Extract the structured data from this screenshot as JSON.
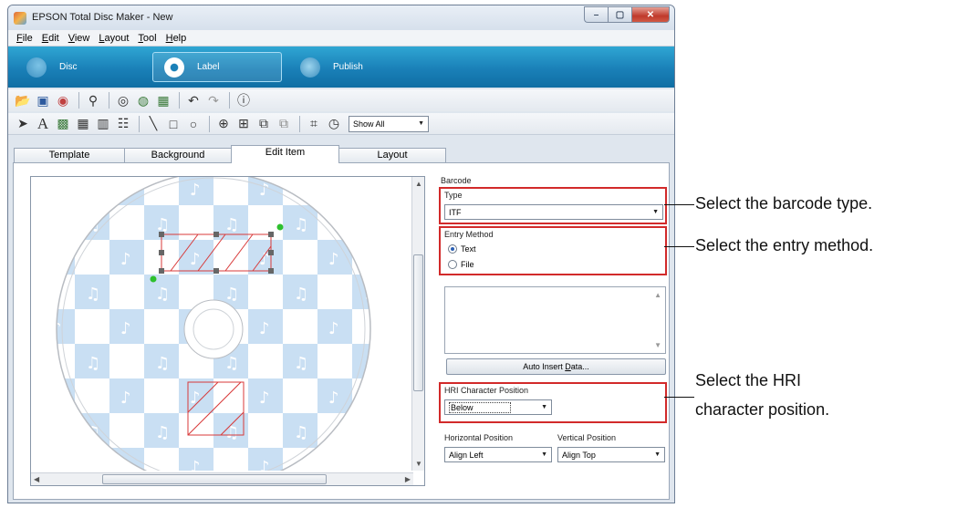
{
  "window": {
    "title": "EPSON Total Disc Maker - New"
  },
  "menu": [
    {
      "u": "F",
      "rest": "ile"
    },
    {
      "u": "E",
      "rest": "dit"
    },
    {
      "u": "V",
      "rest": "iew"
    },
    {
      "u": "L",
      "rest": "ayout"
    },
    {
      "u": "T",
      "rest": "ool"
    },
    {
      "u": "H",
      "rest": "elp"
    }
  ],
  "modes": {
    "disc": "Disc",
    "label": "Label",
    "publish": "Publish"
  },
  "toolbar": {
    "show_all": "Show All"
  },
  "tabs": [
    "Template",
    "Background",
    "Edit Item",
    "Layout"
  ],
  "panel": {
    "barcode_label": "Barcode",
    "type_label": "Type",
    "type_value": "ITF",
    "entry_label": "Entry Method",
    "entry_text": "Text",
    "entry_file": "File",
    "auto_insert_pre": "Auto Insert ",
    "auto_insert_ul": "D",
    "auto_insert_post": "ata...",
    "hri_label": "HRI Character Position",
    "hri_value": "Below",
    "hpos_label": "Horizontal Position",
    "hpos_value": "Align Left",
    "vpos_label": "Vertical Position",
    "vpos_value": "Align Top"
  },
  "callouts": {
    "type": "Select the barcode type.",
    "entry": "Select the entry method.",
    "hri_line1": "Select the HRI",
    "hri_line2": "character position."
  },
  "colors": {
    "mode_bar": "#1a80b8",
    "highlight": "#d22a2a",
    "disc_pattern": "#c9dff3"
  }
}
